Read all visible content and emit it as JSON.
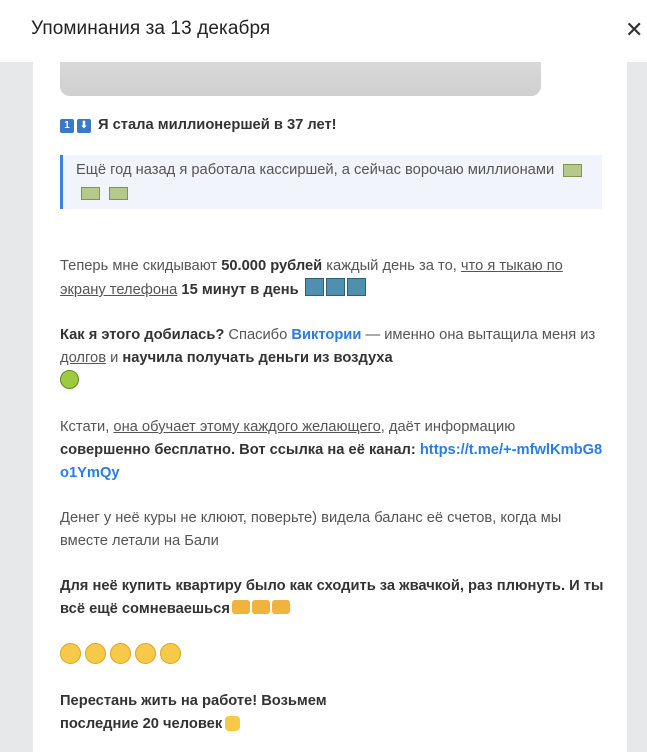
{
  "modal": {
    "title": "Упоминания за 13 декабря",
    "close_label": "✕"
  },
  "post": {
    "heading": "Я стала миллионершей в 37 лет!",
    "heading_emojis": [
      "1",
      "⬇"
    ],
    "quote": "Ещё год назад я работала кассиршей, а сейчас ворочаю миллионами",
    "p1": {
      "t1": "Теперь мне скидывают ",
      "b1": "50.000 рублей",
      "t2": " каждый день за то, ",
      "u1": "что я тыкаю по экрану телефона",
      "t3": " ",
      "b2": "15 минут в день"
    },
    "p2": {
      "b1": "Как я этого добилась?",
      "t1": " Спасибо ",
      "link": "Виктории",
      "t2": " — именно она вытащила меня из ",
      "u1": "долгов",
      "t3": " и ",
      "b2": "научила получать деньги из воздуха"
    },
    "p3": {
      "t1": "Кстати, ",
      "u1": "она обучает этому каждого желающего",
      "t2": ", даёт информацию ",
      "b1": "совершенно бесплатно. Вот ссылка на её канал:",
      "t3": " ",
      "link": "https://t.me/+-mfwlKmbG8o1YmQy"
    },
    "p4": "Денег у неё куры не клюют, поверьте) видела баланс её счетов, когда мы вместе летали на Бали",
    "p5": "Для неё купить квартиру было как сходить за жвачкой, раз плюнуть. И ты всё ещё сомневаешься",
    "p6": "Перестань жить на работе! Возьмем последние 20 человек"
  }
}
